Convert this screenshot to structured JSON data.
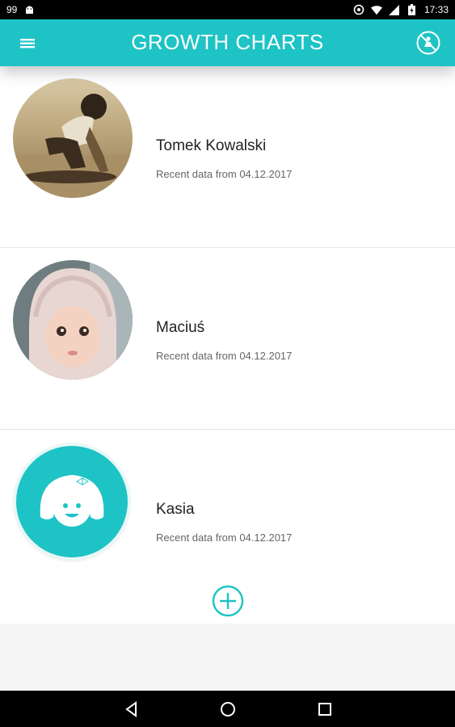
{
  "status_bar": {
    "notification_count": "99",
    "time": "17:33"
  },
  "app_bar": {
    "title": "GROWTH CHARTS",
    "color": "#1ec3c5"
  },
  "children": [
    {
      "name": "Tomek Kowalski",
      "subtitle": "Recent data from 04.12.2017",
      "avatar": "photo-boy-skateboard"
    },
    {
      "name": "Maciuś",
      "subtitle": "Recent data from 04.12.2017",
      "avatar": "photo-baby-hat"
    },
    {
      "name": "Kasia",
      "subtitle": "Recent data from 04.12.2017",
      "avatar": "girl-face-icon"
    }
  ],
  "actions": {
    "add_icon": "add-circle-icon"
  }
}
